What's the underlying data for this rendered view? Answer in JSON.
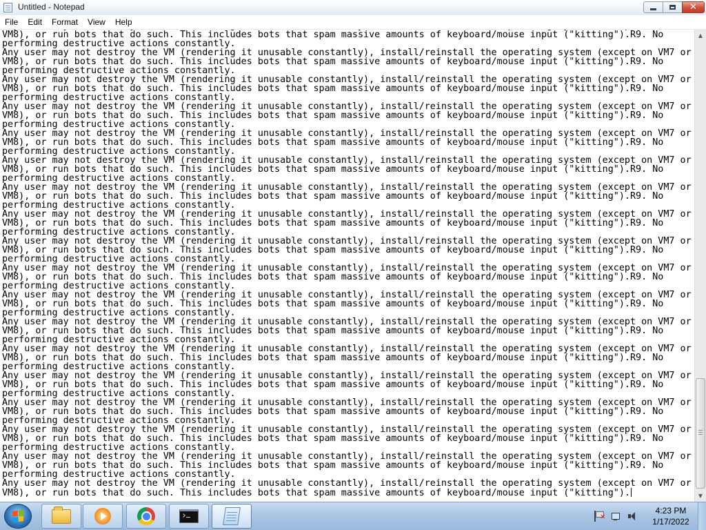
{
  "window": {
    "title": "Untitled - Notepad",
    "close_glyph": "✕"
  },
  "menu": {
    "items": [
      "File",
      "Edit",
      "Format",
      "View",
      "Help"
    ]
  },
  "editor": {
    "first_fragment": "VM8), or run bots that do such. This includes bots that spam massive amounts of keyboard/mouse input (\"kitting\").R9. No",
    "tail_fragment": "performing destructive actions constantly.",
    "paragraph_line_1": "Any user may not destroy the VM (rendering it unusable constantly), install/reinstall the operating system (except on VM7 or",
    "paragraph_line_2": "VM8), or run bots that do such. This includes bots that spam massive amounts of keyboard/mouse input (\"kitting\").R9. No",
    "paragraph_line_3": "performing destructive actions constantly.",
    "repeated_paragraph_count": 17,
    "last_line_1": "Any user may not destroy the VM (rendering it unusable constantly), install/reinstall the operating system (except on VM7 or",
    "last_line_2": "VM8), or run bots that do such. This includes bots that spam massive amounts of keyboard/mouse input (\"kitting\")."
  },
  "taskbar": {
    "apps": [
      {
        "name": "explorer",
        "active": false
      },
      {
        "name": "media-player",
        "active": false
      },
      {
        "name": "chrome",
        "active": false
      },
      {
        "name": "command-prompt",
        "active": false
      },
      {
        "name": "notepad",
        "active": true
      }
    ],
    "clock_time": "4:23 PM",
    "clock_date": "1/17/2022"
  }
}
